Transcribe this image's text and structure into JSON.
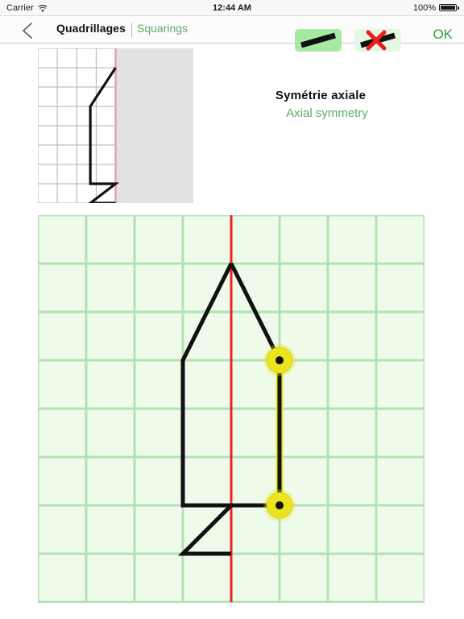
{
  "status_bar": {
    "carrier": "Carrier",
    "wifi_icon": "wifi-icon",
    "time": "12:44 AM",
    "battery_percent": "100%",
    "battery_icon": "battery-full-icon"
  },
  "nav_bar": {
    "back_icon": "chevron-left-icon",
    "title": "Quadrillages",
    "subtitle": "Squarings",
    "tools": [
      {
        "name": "draw-line-tool",
        "icon": "line-segment-icon",
        "active": true
      },
      {
        "name": "erase-tool",
        "icon": "line-with-red-cross-icon",
        "active": false
      }
    ],
    "ok_label": "OK"
  },
  "heading": {
    "title_fr": "Symétrie axiale",
    "title_en": "Axial symmetry"
  },
  "colors": {
    "accent_green": "#5fab63",
    "ok_green": "#2e9b3d",
    "tool_active_bg": "#a7e8a3",
    "tool_inactive_bg": "#e4f7e2",
    "grid_line": "#b6dfb4",
    "grid_fill": "#eefbea",
    "axis_red": "#ee2222",
    "stroke_black": "#111111",
    "handle_yellow": "#ece41f",
    "thumb_grid_line": "#b0b0b0",
    "thumb_mask": "#e2e2e2",
    "thumb_axis": "#e8a0b0"
  },
  "thumbnail": {
    "name": "reference-figure-thumbnail",
    "cols": 8,
    "rows": 8,
    "cell": 24,
    "axis_col": 4,
    "masked_from_col": 4,
    "figure_points": [
      [
        4,
        1
      ],
      [
        2.7,
        3
      ],
      [
        2.7,
        7
      ],
      [
        4,
        7
      ],
      [
        2.7,
        8
      ],
      [
        4,
        8
      ]
    ]
  },
  "chart_data": {
    "type": "grid-drawing",
    "title": "Axial symmetry construction grid",
    "cols": 8,
    "rows": 8,
    "cell": 60,
    "origin": [
      0,
      0
    ],
    "axis": {
      "type": "vertical",
      "col": 4,
      "color": "#ee2222"
    },
    "shape_left": {
      "name": "given-half-figure",
      "color": "#111111",
      "points": [
        [
          4,
          1
        ],
        [
          3,
          3
        ],
        [
          3,
          6
        ],
        [
          4,
          6
        ],
        [
          3,
          7
        ],
        [
          4,
          7
        ]
      ]
    },
    "shape_right": {
      "name": "user-drawn-segment",
      "color": "#111111",
      "points": [
        [
          4,
          1
        ],
        [
          5,
          3
        ],
        [
          5,
          6
        ],
        [
          4,
          6
        ]
      ]
    },
    "highlighted_segment": {
      "name": "selected-segment",
      "color": "#ece41f",
      "from": [
        5,
        3
      ],
      "to": [
        5,
        6
      ]
    },
    "handles": [
      {
        "name": "segment-handle-top",
        "col": 5,
        "row": 3
      },
      {
        "name": "segment-handle-bottom",
        "col": 5,
        "row": 6
      }
    ]
  }
}
